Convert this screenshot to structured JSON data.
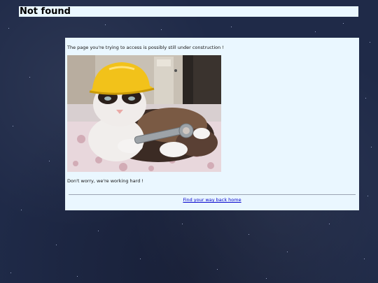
{
  "page": {
    "title": "Not found"
  },
  "content": {
    "message": "The page you're trying to access is possibly still under construction !",
    "reassurance": "Don't worry, we're working hard !",
    "home_link": "Find your way back home",
    "image": {
      "subject": "cat-with-hard-hat-and-wrench"
    }
  },
  "colors": {
    "background": "#1f2a48",
    "panel": "#eaf7ff",
    "link": "#0000cc",
    "hard_hat": "#f2c21a"
  }
}
